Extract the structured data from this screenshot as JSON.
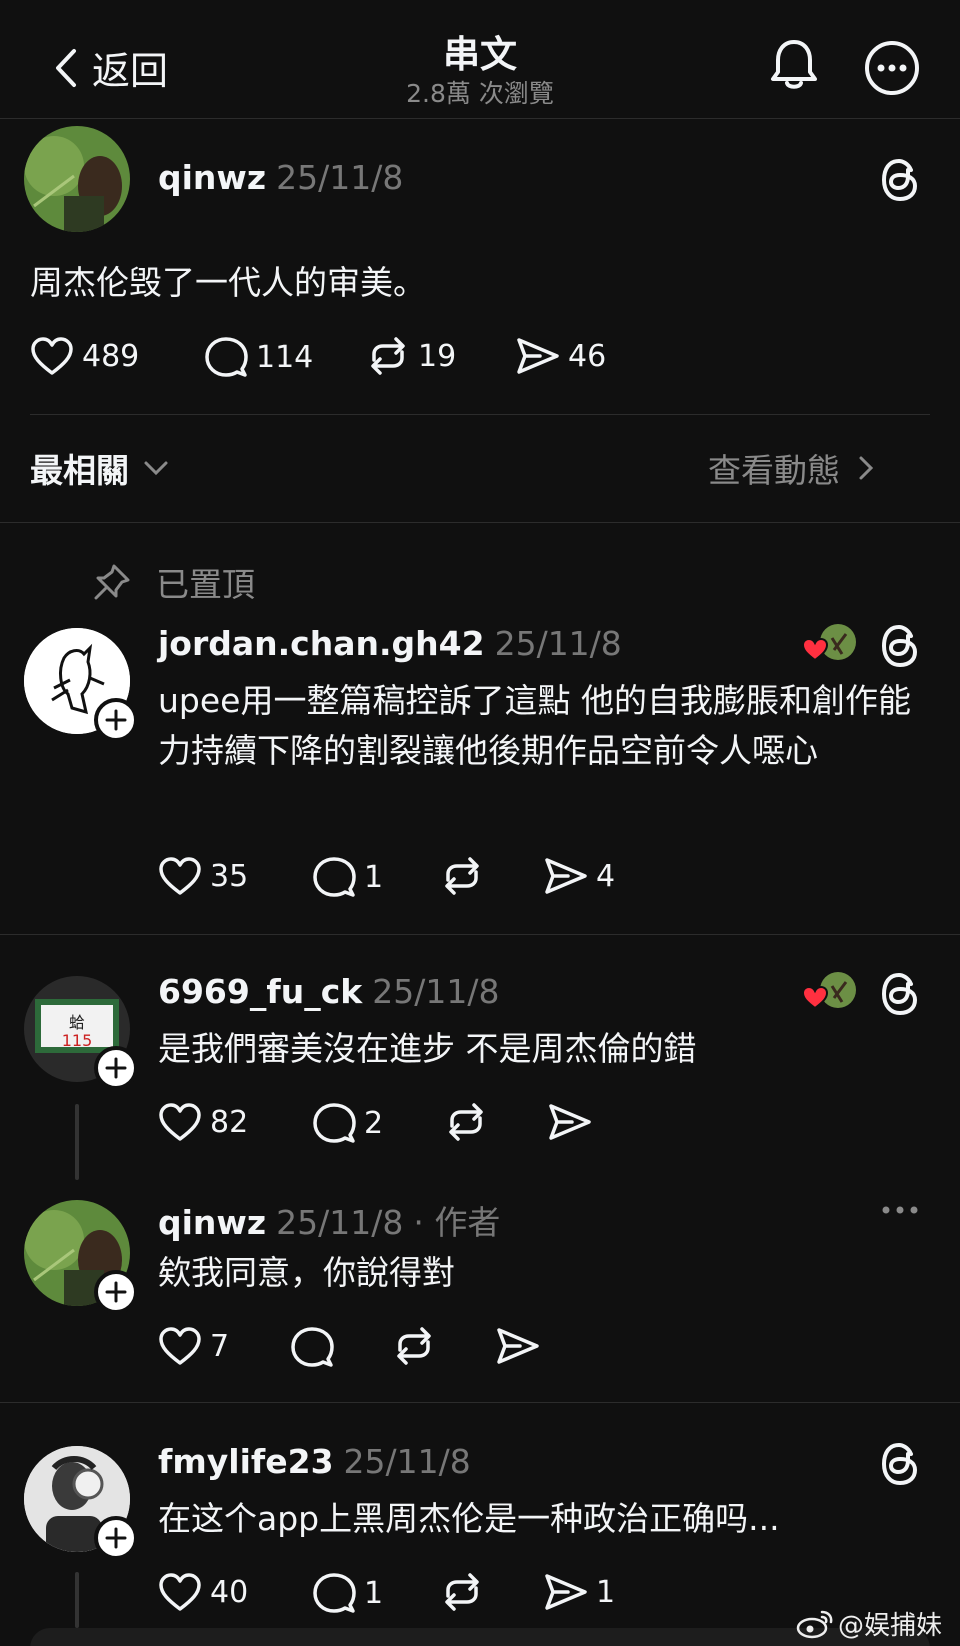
{
  "header": {
    "back_label": "返回",
    "title": "串文",
    "views": "2.8萬 次瀏覽"
  },
  "post": {
    "username": "qinwz",
    "date": "25/11/8",
    "text": "周杰伦毁了一代人的审美。",
    "likes": "489",
    "comments": "114",
    "reposts": "19",
    "shares": "46"
  },
  "sort": {
    "label": "最相關",
    "activity_label": "查看動態"
  },
  "pinned_label": "已置頂",
  "replies": [
    {
      "username": "jordan.chan.gh42",
      "date": "25/11/8",
      "text": "upee用一整篇稿控訴了這點 他的自我膨脹和創作能力持續下降的割裂讓他後期作品空前令人噁心",
      "likes": "35",
      "comments": "1",
      "reposts": "",
      "shares": "4"
    },
    {
      "username": "6969_fu_ck",
      "date": "25/11/8",
      "text": "是我們審美沒在進步 不是周杰倫的錯",
      "likes": "82",
      "comments": "2",
      "reposts": "",
      "shares": ""
    },
    {
      "username": "qinwz",
      "date": "25/11/8",
      "author_tag": "· 作者",
      "text": "欸我同意，你說得對",
      "likes": "7",
      "comments": "",
      "reposts": "",
      "shares": ""
    },
    {
      "username": "fmylife23",
      "date": "25/11/8",
      "text": "在这个app上黑周杰伦是一种政治正确吗...",
      "likes": "40",
      "comments": "1",
      "reposts": "",
      "shares": "1"
    }
  ],
  "watermark": "@娱捕妹",
  "icons": [
    "chevron-left-icon",
    "bell-icon",
    "more-icon",
    "threads-icon",
    "heart-icon",
    "comment-icon",
    "repost-icon",
    "share-icon",
    "pin-icon",
    "plus-icon",
    "weibo-icon"
  ],
  "colors": {
    "background": "#101010",
    "text": "#f3f5f7",
    "muted": "#777777",
    "heart_badge": "#ff3040"
  }
}
